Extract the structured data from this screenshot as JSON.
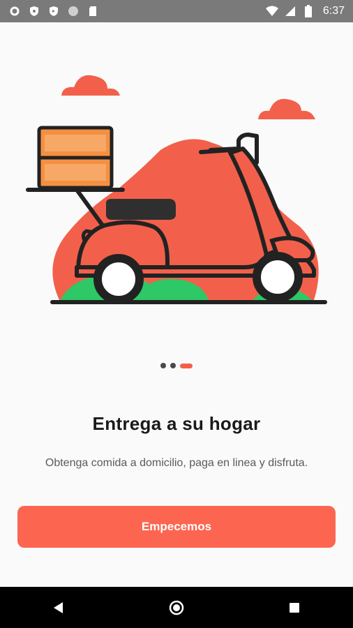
{
  "status_bar": {
    "time": "6:37",
    "left_icons": [
      "settings-icon",
      "shield-icon",
      "shield-icon",
      "circle-icon",
      "sim-card-icon"
    ],
    "right_icons": [
      "wifi-icon",
      "signal-icon",
      "battery-icon"
    ]
  },
  "onboarding": {
    "title": "Entrega a su hogar",
    "subtitle": "Obtenga comida a domicilio, paga en linea y disfruta.",
    "cta_label": "Empecemos",
    "pager": {
      "total": 3,
      "current": 3
    }
  },
  "colors": {
    "accent": "#fc6651",
    "scooter": "#f2604b",
    "box": "#f59042",
    "grass": "#2ec866",
    "outline": "#222222"
  },
  "nav_bar": {
    "buttons": [
      "back-icon",
      "home-icon",
      "recents-icon"
    ]
  }
}
